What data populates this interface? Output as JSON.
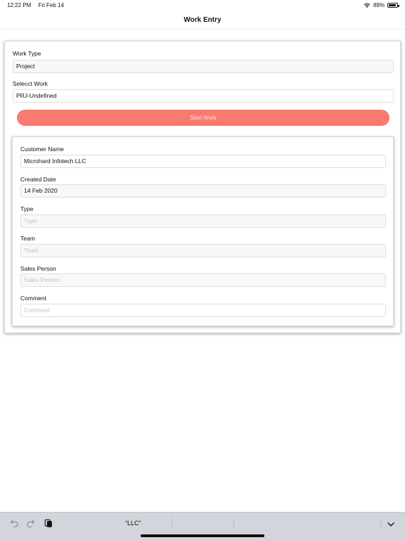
{
  "status": {
    "time": "12:22 PM",
    "date": "Fri Feb 14",
    "battery": "89%",
    "battery_level": 0.89
  },
  "nav": {
    "title": "Work Entry"
  },
  "work_form": {
    "work_type_label": "Work Type",
    "work_type_value": "Project",
    "select_work_label": "Selecct Work",
    "select_work_value": "PRJ-Undefined",
    "start_button": "Start Work"
  },
  "customer_form": {
    "customer_name_label": "Customer Name",
    "customer_name_value": "Microhard Infotech LLC",
    "created_date_label": "Created Date",
    "created_date_value": "14 Feb 2020",
    "type_label": "Type",
    "type_placeholder": "Type",
    "team_label": "Team",
    "team_placeholder": "Team",
    "sales_person_label": "Sales Person",
    "sales_person_placeholder": "Sales Person",
    "comment_label": "Comment",
    "comment_placeholder": "Comment"
  },
  "keyboard": {
    "suggestion": "“LLC”",
    "icons": [
      "undo-icon",
      "redo-icon",
      "paste-icon",
      "keyboard-dismiss-icon"
    ]
  },
  "colors": {
    "accent": "#f97b6f",
    "keyboard_bar": "#d2d5db"
  }
}
